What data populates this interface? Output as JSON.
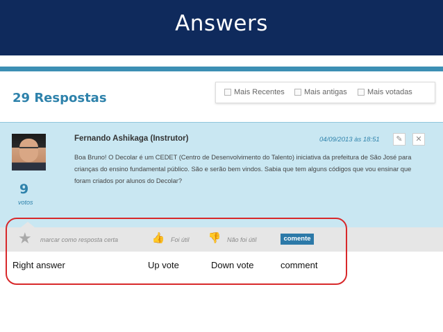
{
  "slide": {
    "title": "Answers"
  },
  "header": {
    "count_title": "29 Respostas"
  },
  "filters": [
    {
      "label": "Mais Recentes"
    },
    {
      "label": "Mais antigas"
    },
    {
      "label": "Mais votadas"
    }
  ],
  "answer": {
    "author": "Fernando Ashikaga (Instrutor)",
    "date": "04/09/2013 às 18:51",
    "text": "Boa Bruno! O Decolar é um CEDET (Centro de Desenvolvimento do Talento) iniciativa da prefeitura de São José para crianças do ensino fundamental público. São e serão bem vindos. Sabia que tem alguns códigos que vou ensinar que foram criados por alunos do Decolar?",
    "votes": "9",
    "votes_label": "votos",
    "icons": {
      "edit": "pencil-icon",
      "close": "close-icon",
      "avatar": "user-photo"
    }
  },
  "actions": {
    "mark_correct": "marcar como resposta certa",
    "useful": "Foi útil",
    "not_useful": "Não foi útil",
    "comment": "comente",
    "icons": {
      "star": "star-icon",
      "up": "thumbs-up-icon",
      "down": "thumbs-down-icon"
    }
  },
  "annotations": {
    "right_answer": "Right answer",
    "up_vote": "Up vote",
    "down_vote": "Down vote",
    "comment": "comment"
  },
  "colors": {
    "title_bar": "#0f2a5c",
    "accent_blue": "#2e82ab",
    "answer_bg": "#c9e7f2",
    "highlight_red": "#d8282a"
  }
}
